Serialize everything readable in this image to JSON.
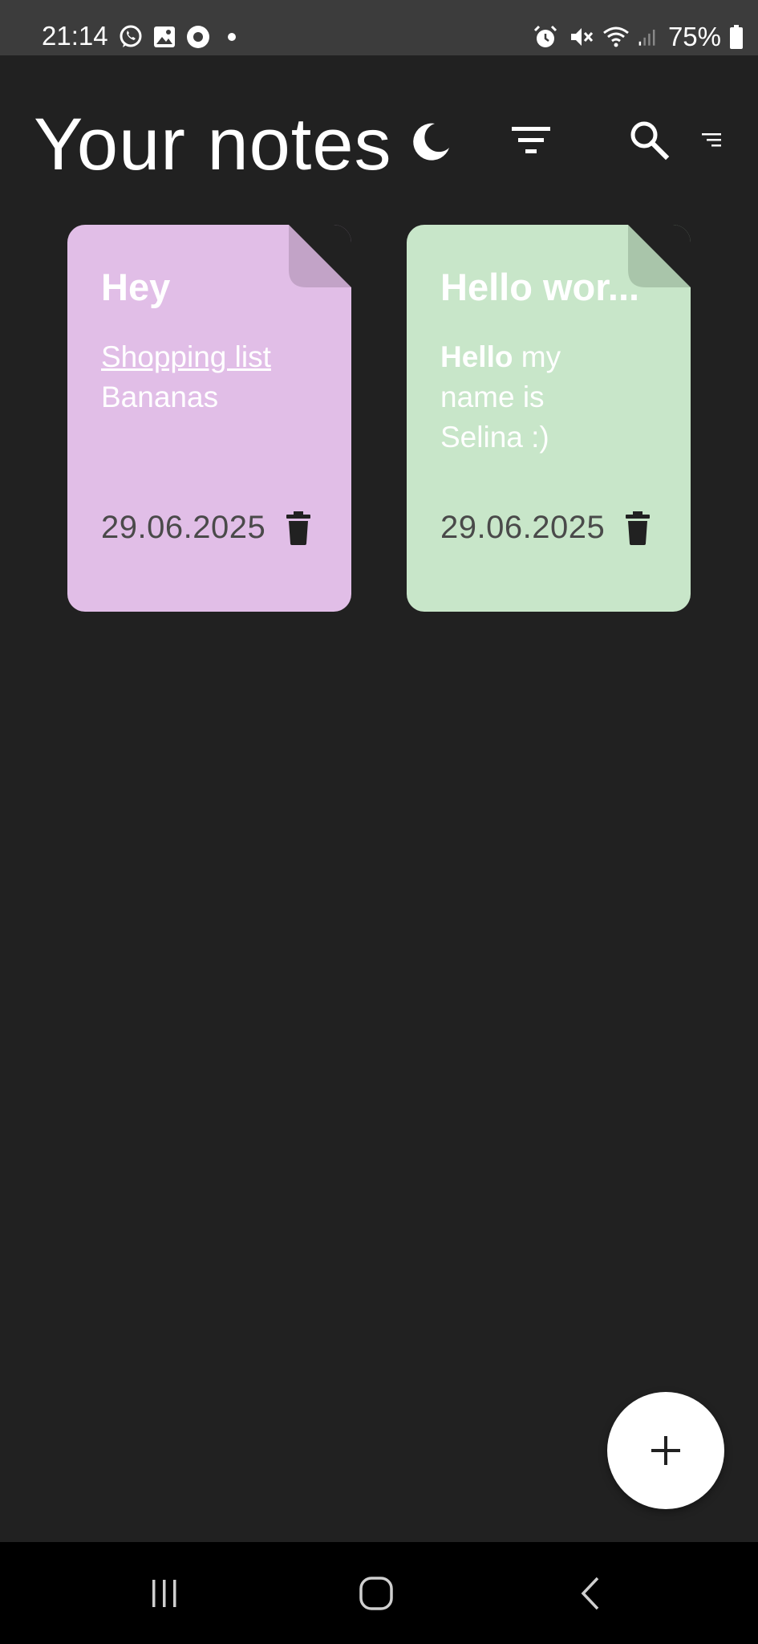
{
  "status_bar": {
    "time": "21:14",
    "left_icons": [
      "whatsapp-icon",
      "gallery-icon",
      "circle-app-icon",
      "notification-dot-icon"
    ],
    "right_icons": [
      "alarm-icon",
      "mute-icon",
      "wifi-icon",
      "signal-icon",
      "battery-icon"
    ],
    "battery": "75%"
  },
  "header": {
    "title": "Your notes",
    "actions": [
      "dark-mode-icon",
      "filter-icon",
      "search-icon",
      "sort-icon"
    ]
  },
  "notes": [
    {
      "title": "Hey",
      "line1": "Shopping list",
      "line2": "Bananas",
      "date": "29.06.2025",
      "color": "#e1bee7",
      "fold_color": "#c2a3c7"
    },
    {
      "title": "Hello wor...",
      "bold_word": "Hello",
      "line1_rest": " my",
      "line2": "name is",
      "line3": "Selina :)",
      "date": "29.06.2025",
      "color": "#c8e6c9",
      "fold_color": "#a9c5aa"
    }
  ],
  "fab": {
    "icon": "plus-icon"
  },
  "nav_bar": {
    "buttons": [
      "recent-apps-icon",
      "home-icon",
      "back-icon"
    ]
  },
  "colors": {
    "background": "#212121",
    "status_bar": "#3c3c3c",
    "nav_bar": "#000000"
  }
}
